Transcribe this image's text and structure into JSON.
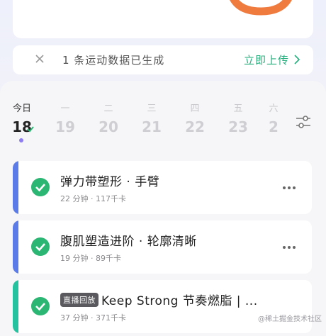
{
  "colors": {
    "accent_green": "#27b07e",
    "check_green": "#2bb673",
    "ring": "#f07b3f",
    "purple_dot": "#8d7cf2",
    "bar_blue": "#5b7be8",
    "bar_teal": "#25c2a0"
  },
  "notice": {
    "text": "1 条运动数据已生成",
    "action": "立即上传",
    "close_icon": "close-icon",
    "chevron_icon": "chevron-right-icon"
  },
  "calendar": {
    "days": [
      {
        "weekday": "今日",
        "date": "18",
        "active": true
      },
      {
        "weekday": "一",
        "date": "19"
      },
      {
        "weekday": "二",
        "date": "20"
      },
      {
        "weekday": "三",
        "date": "21"
      },
      {
        "weekday": "四",
        "date": "22"
      },
      {
        "weekday": "五",
        "date": "23"
      },
      {
        "weekday": "六",
        "date": "2"
      }
    ],
    "filter_icon": "filter-sliders-icon"
  },
  "workouts": [
    {
      "title": "弹力带塑形 · 手臂",
      "meta": "22 分钟 · 117千卡"
    },
    {
      "title": "腹肌塑造进阶 · 轮廓清晰",
      "meta": "19 分钟 · 89千卡"
    },
    {
      "badge": "直播回放",
      "title": "Keep Strong 节奏燃脂 | ...",
      "meta": "37 分钟 · 371千卡"
    }
  ],
  "watermark": "@稀土掘金技术社区"
}
